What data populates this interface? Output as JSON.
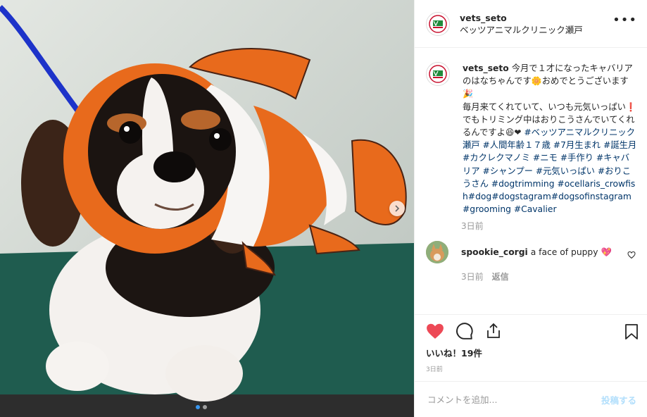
{
  "header": {
    "username": "vets_seto",
    "location": "ベッツアニマルクリニック瀬戸",
    "more_icon": "ellipsis-horizontal-icon"
  },
  "caption": {
    "username": "vets_seto",
    "line1": "今月で１才になったキャバリアのはなちゃんです",
    "emoji1": "🌼",
    "line2": "おめでとうございます",
    "emoji2": "🎉",
    "line3": "毎月来てくれていて、いつも元気いっぱい",
    "emoji3": "❗",
    "line4": "でもトリミング中はおりこうさんでいてくれるんですよ",
    "emoji4": "😆",
    "emoji5": "❤",
    "hashtags": "#ベッツアニマルクリニック瀬戸 #人間年齢１７歳 #7月生まれ #誕生月 #カクレクマノミ #ニモ #手作り #キャバリア #シャンプー #元気いっぱい #おりこうさん #dogtrimming #ocellaris_crowfish#dog#dogstagram#dogsofinstagram #grooming #Cavalier",
    "time": "3日前"
  },
  "comment": {
    "username": "spookie_corgi",
    "text": "a face of puppy",
    "emoji": "💖",
    "time": "3日前",
    "reply": "返信"
  },
  "actions": {
    "like_icon": "heart-filled-icon",
    "comment_icon": "comment-bubble-icon",
    "share_icon": "share-icon",
    "save_icon": "bookmark-icon",
    "like_color": "#ed4956"
  },
  "likes": "いいね！19件",
  "post_date": "3日前",
  "add_comment": {
    "placeholder": "コメントを追加...",
    "post_label": "投稿する"
  },
  "carousel": {
    "next_icon": "chevron-right-icon",
    "slides": 2,
    "active_slide": 1
  }
}
